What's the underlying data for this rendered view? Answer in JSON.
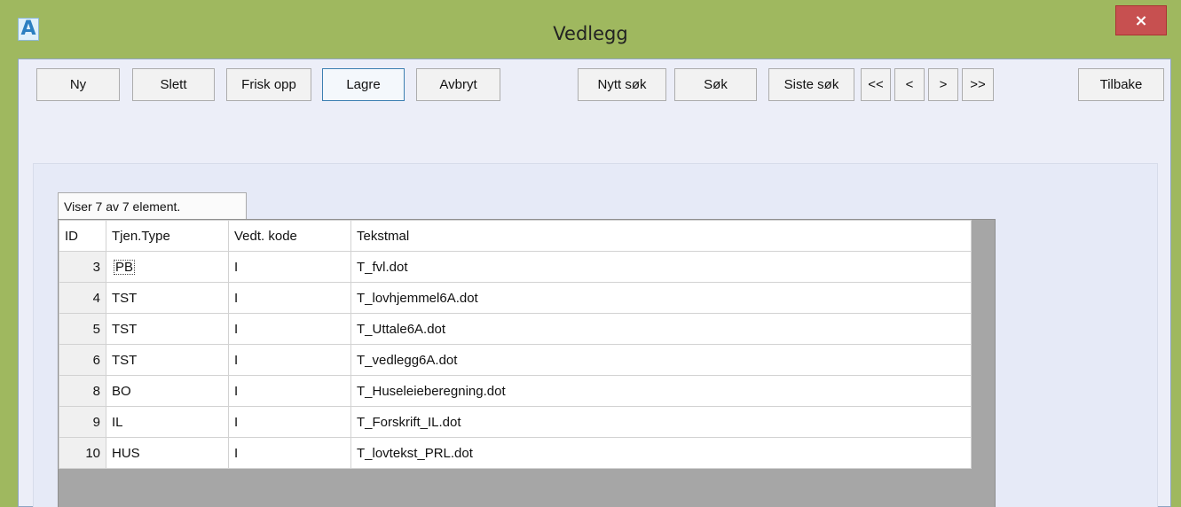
{
  "window": {
    "title": "Vedlegg",
    "icon_letter": "A",
    "close_label": "×"
  },
  "toolbar": {
    "ny": "Ny",
    "slett": "Slett",
    "frisk_opp": "Frisk opp",
    "lagre": "Lagre",
    "avbryt": "Avbryt",
    "nytt_sok": "Nytt søk",
    "sok": "Søk",
    "siste_sok": "Siste søk",
    "first": "<<",
    "prev": "<",
    "next": ">",
    "last": ">>",
    "tilbake": "Tilbake"
  },
  "grid": {
    "status": "Viser 7 av 7 element.",
    "columns": [
      "ID",
      "Tjen.Type",
      "Vedt. kode",
      "Tekstmal"
    ],
    "rows": [
      {
        "id": "3",
        "type": "PB",
        "kode": "I",
        "mal": "T_fvl.dot"
      },
      {
        "id": "4",
        "type": "TST",
        "kode": "I",
        "mal": "T_lovhjemmel6A.dot"
      },
      {
        "id": "5",
        "type": "TST",
        "kode": "I",
        "mal": "T_Uttale6A.dot"
      },
      {
        "id": "6",
        "type": "TST",
        "kode": "I",
        "mal": "T_vedlegg6A.dot"
      },
      {
        "id": "8",
        "type": "BO",
        "kode": "I",
        "mal": "T_Huseleieberegning.dot"
      },
      {
        "id": "9",
        "type": "IL",
        "kode": "I",
        "mal": "T_Forskrift_IL.dot"
      },
      {
        "id": "10",
        "type": "HUS",
        "kode": "I",
        "mal": "T_lovtekst_PRL.dot"
      }
    ]
  },
  "colors": {
    "window_frame": "#9fb85f",
    "close_button": "#c75050",
    "client_background": "#eceef8",
    "grid_empty_area": "#a6a6a6"
  }
}
